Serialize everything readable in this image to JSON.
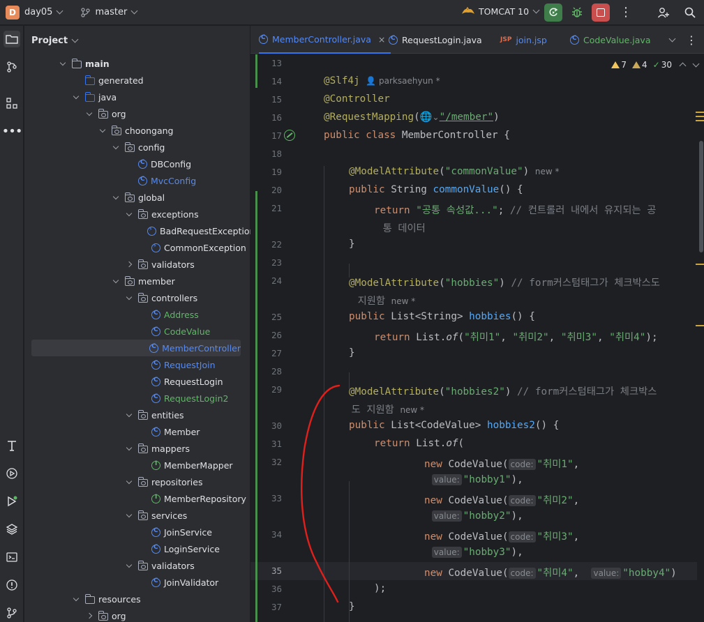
{
  "titlebar": {
    "project_badge": "D",
    "project_name": "day05",
    "branch": "master",
    "run_config": "TOMCAT 10"
  },
  "project_panel": {
    "title": "Project",
    "tree": [
      {
        "depth": 3,
        "label": "main",
        "icon": "folder",
        "state": "open",
        "color": "default",
        "bold": true
      },
      {
        "depth": 4,
        "label": "generated",
        "icon": "src-folder",
        "state": "none",
        "color": "default"
      },
      {
        "depth": 4,
        "label": "java",
        "icon": "src-folder",
        "state": "open",
        "color": "default"
      },
      {
        "depth": 5,
        "label": "org",
        "icon": "package",
        "state": "open",
        "color": "default"
      },
      {
        "depth": 6,
        "label": "choongang",
        "icon": "package",
        "state": "open",
        "color": "default"
      },
      {
        "depth": 7,
        "label": "config",
        "icon": "package",
        "state": "open",
        "color": "default"
      },
      {
        "depth": 8,
        "label": "DBConfig",
        "icon": "class",
        "state": "none",
        "color": "default"
      },
      {
        "depth": 8,
        "label": "MvcConfig",
        "icon": "class",
        "state": "none",
        "color": "blue"
      },
      {
        "depth": 7,
        "label": "global",
        "icon": "package",
        "state": "open",
        "color": "default"
      },
      {
        "depth": 8,
        "label": "exceptions",
        "icon": "package",
        "state": "open",
        "color": "default"
      },
      {
        "depth": 9,
        "label": "BadRequestException",
        "icon": "exception",
        "state": "none",
        "color": "default"
      },
      {
        "depth": 9,
        "label": "CommonException",
        "icon": "exception",
        "state": "none",
        "color": "default"
      },
      {
        "depth": 8,
        "label": "validators",
        "icon": "package",
        "state": "closed",
        "color": "default"
      },
      {
        "depth": 7,
        "label": "member",
        "icon": "package",
        "state": "open",
        "color": "default"
      },
      {
        "depth": 8,
        "label": "controllers",
        "icon": "package",
        "state": "open",
        "color": "default"
      },
      {
        "depth": 9,
        "label": "Address",
        "icon": "class",
        "state": "none",
        "color": "green"
      },
      {
        "depth": 9,
        "label": "CodeValue",
        "icon": "class",
        "state": "none",
        "color": "green"
      },
      {
        "depth": 9,
        "label": "MemberController",
        "icon": "class",
        "state": "none",
        "color": "blue",
        "selected": true
      },
      {
        "depth": 9,
        "label": "RequestJoin",
        "icon": "class",
        "state": "none",
        "color": "blue"
      },
      {
        "depth": 9,
        "label": "RequestLogin",
        "icon": "class",
        "state": "none",
        "color": "default"
      },
      {
        "depth": 9,
        "label": "RequestLogin2",
        "icon": "class",
        "state": "none",
        "color": "green"
      },
      {
        "depth": 8,
        "label": "entities",
        "icon": "package",
        "state": "open",
        "color": "default"
      },
      {
        "depth": 9,
        "label": "Member",
        "icon": "class",
        "state": "none",
        "color": "default"
      },
      {
        "depth": 8,
        "label": "mappers",
        "icon": "package",
        "state": "open",
        "color": "default"
      },
      {
        "depth": 9,
        "label": "MemberMapper",
        "icon": "interface",
        "state": "none",
        "color": "default"
      },
      {
        "depth": 8,
        "label": "repositories",
        "icon": "package",
        "state": "open",
        "color": "default"
      },
      {
        "depth": 9,
        "label": "MemberRepository",
        "icon": "interface",
        "state": "none",
        "color": "default"
      },
      {
        "depth": 8,
        "label": "services",
        "icon": "package",
        "state": "open",
        "color": "default"
      },
      {
        "depth": 9,
        "label": "JoinService",
        "icon": "class",
        "state": "none",
        "color": "default"
      },
      {
        "depth": 9,
        "label": "LoginService",
        "icon": "class",
        "state": "none",
        "color": "default"
      },
      {
        "depth": 8,
        "label": "validators",
        "icon": "package",
        "state": "open",
        "color": "default"
      },
      {
        "depth": 9,
        "label": "JoinValidator",
        "icon": "class",
        "state": "none",
        "color": "default"
      },
      {
        "depth": 4,
        "label": "resources",
        "icon": "res-folder",
        "state": "open",
        "color": "default"
      },
      {
        "depth": 5,
        "label": "org",
        "icon": "package",
        "state": "closed",
        "color": "default"
      }
    ]
  },
  "tabs": [
    {
      "label": "MemberController.java",
      "icon": "class",
      "active": true,
      "closable": true
    },
    {
      "label": "RequestLogin.java",
      "icon": "class",
      "active": false
    },
    {
      "label": "join.jsp",
      "icon": "jsp",
      "active": false,
      "prefix": "JSP"
    },
    {
      "label": "CodeValue.java",
      "icon": "class",
      "active": false
    }
  ],
  "inspections": {
    "warnings": "7",
    "weak_warnings": "4",
    "typos": "30"
  },
  "code": {
    "author_hint": "parksaehyun *",
    "new_hint": "new *",
    "param_code": "code:",
    "param_value": "value:",
    "lines": [
      {
        "n": "13",
        "text": ""
      },
      {
        "n": "14",
        "text": "@Slf4j"
      },
      {
        "n": "15",
        "text": "@Controller"
      },
      {
        "n": "16",
        "text": "@RequestMapping(\"/member\")"
      },
      {
        "n": "17",
        "text": "public class MemberController {"
      },
      {
        "n": "18",
        "text": ""
      },
      {
        "n": "19",
        "text": "@ModelAttribute(\"commonValue\")"
      },
      {
        "n": "20",
        "text": "public String commonValue() {"
      },
      {
        "n": "21",
        "text": "return \"공통 속성값...\"; // 컨트롤러 내에서 유지되는 공통 데이터"
      },
      {
        "n": "22",
        "text": "}"
      },
      {
        "n": "23",
        "text": ""
      },
      {
        "n": "24",
        "text": "@ModelAttribute(\"hobbies\") // form커스텀태그가 체크박스도 지원함"
      },
      {
        "n": "25",
        "text": "public List<String> hobbies() {"
      },
      {
        "n": "26",
        "text": "return List.of(\"취미1\", \"취미2\", \"취미3\", \"취미4\");"
      },
      {
        "n": "27",
        "text": "}"
      },
      {
        "n": "28",
        "text": ""
      },
      {
        "n": "29",
        "text": "@ModelAttribute(\"hobbies2\") // form커스텀태그가 체크박스도 지원함"
      },
      {
        "n": "30",
        "text": "public List<CodeValue> hobbies2() {"
      },
      {
        "n": "31",
        "text": "return List.of("
      },
      {
        "n": "32",
        "text": "new CodeValue(\"취미1\", \"hobby1\"),"
      },
      {
        "n": "33",
        "text": "new CodeValue(\"취미2\", \"hobby2\"),"
      },
      {
        "n": "34",
        "text": "new CodeValue(\"취미3\", \"hobby3\"),"
      },
      {
        "n": "35",
        "text": "new CodeValue(\"취미4\", \"hobby4\")"
      },
      {
        "n": "36",
        "text": ");"
      },
      {
        "n": "37",
        "text": "}"
      }
    ]
  },
  "colors": {
    "accent": "#3574f0",
    "vcs_added": "#4a8f4d",
    "annotation_pen": "#e0201c"
  }
}
